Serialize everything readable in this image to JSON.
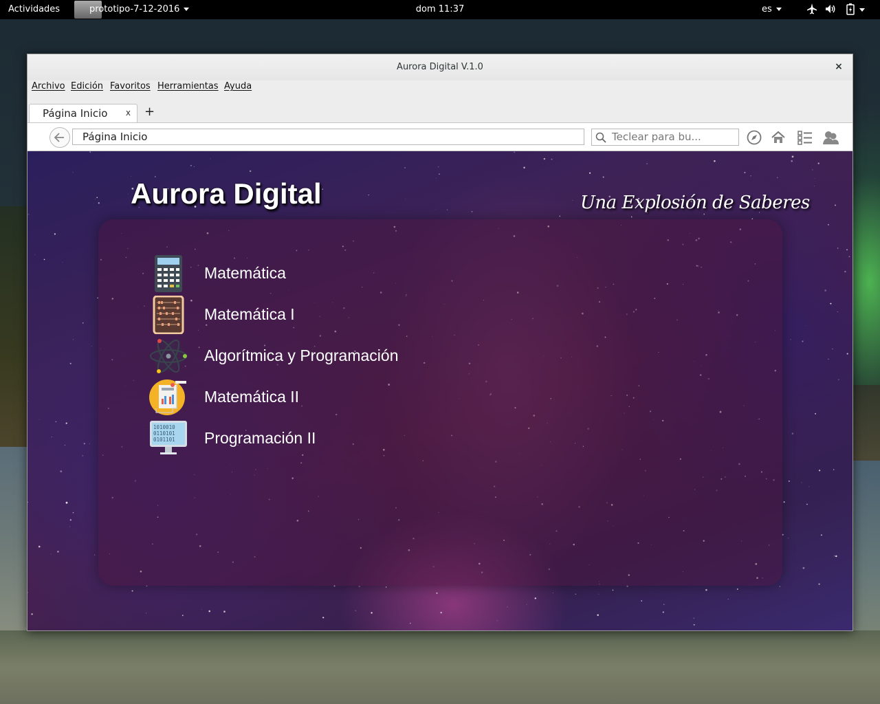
{
  "topbar": {
    "activities": "Actividades",
    "app_name": "prototipo-7-12-2016",
    "clock": "dom 11:37",
    "language": "es"
  },
  "window": {
    "title": "Aurora Digital V.1.0",
    "close": "×"
  },
  "menu": [
    "Archivo",
    "Edición",
    "Favoritos",
    "Herramientas",
    "Ayuda"
  ],
  "tabs": {
    "active_label": "Página Inicio",
    "close": "x",
    "new_tab": "+"
  },
  "navbar": {
    "url": "Página Inicio",
    "search_placeholder": "Teclear para bu..."
  },
  "page": {
    "title": "Aurora Digital",
    "slogan": "Una Explosión de Saberes",
    "courses": [
      {
        "label": "Matemática",
        "icon": "calculator-icon"
      },
      {
        "label": "Matemática I",
        "icon": "abacus-icon"
      },
      {
        "label": "Algorítmica y Programación",
        "icon": "atom-icon"
      },
      {
        "label": "Matemática II",
        "icon": "document-chart-icon"
      },
      {
        "label": "Programación II",
        "icon": "binary-monitor-icon"
      }
    ]
  }
}
